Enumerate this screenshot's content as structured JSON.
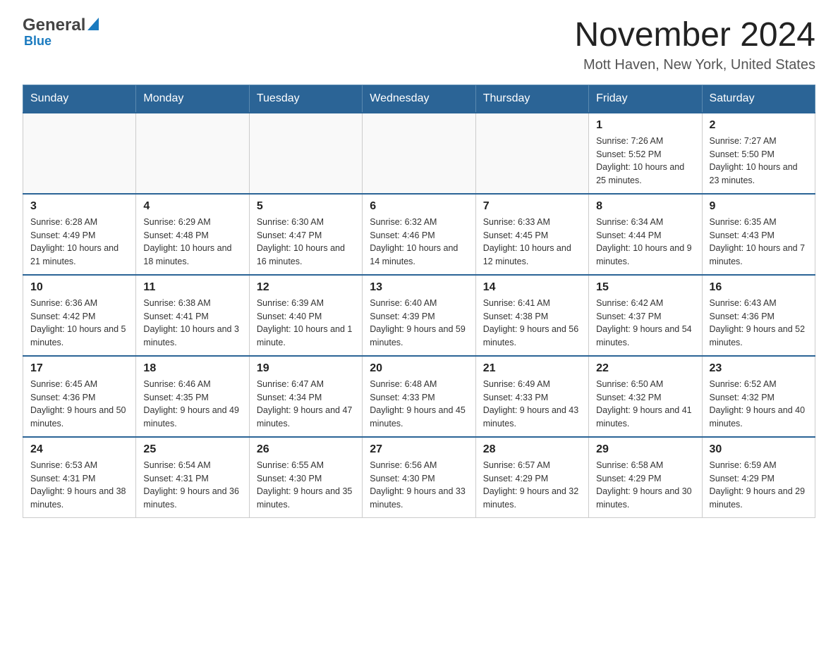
{
  "header": {
    "title": "November 2024",
    "subtitle": "Mott Haven, New York, United States",
    "logo_general": "General",
    "logo_blue": "Blue"
  },
  "days_of_week": [
    "Sunday",
    "Monday",
    "Tuesday",
    "Wednesday",
    "Thursday",
    "Friday",
    "Saturday"
  ],
  "weeks": [
    {
      "days": [
        {
          "num": "",
          "info": ""
        },
        {
          "num": "",
          "info": ""
        },
        {
          "num": "",
          "info": ""
        },
        {
          "num": "",
          "info": ""
        },
        {
          "num": "",
          "info": ""
        },
        {
          "num": "1",
          "info": "Sunrise: 7:26 AM\nSunset: 5:52 PM\nDaylight: 10 hours and 25 minutes."
        },
        {
          "num": "2",
          "info": "Sunrise: 7:27 AM\nSunset: 5:50 PM\nDaylight: 10 hours and 23 minutes."
        }
      ]
    },
    {
      "days": [
        {
          "num": "3",
          "info": "Sunrise: 6:28 AM\nSunset: 4:49 PM\nDaylight: 10 hours and 21 minutes."
        },
        {
          "num": "4",
          "info": "Sunrise: 6:29 AM\nSunset: 4:48 PM\nDaylight: 10 hours and 18 minutes."
        },
        {
          "num": "5",
          "info": "Sunrise: 6:30 AM\nSunset: 4:47 PM\nDaylight: 10 hours and 16 minutes."
        },
        {
          "num": "6",
          "info": "Sunrise: 6:32 AM\nSunset: 4:46 PM\nDaylight: 10 hours and 14 minutes."
        },
        {
          "num": "7",
          "info": "Sunrise: 6:33 AM\nSunset: 4:45 PM\nDaylight: 10 hours and 12 minutes."
        },
        {
          "num": "8",
          "info": "Sunrise: 6:34 AM\nSunset: 4:44 PM\nDaylight: 10 hours and 9 minutes."
        },
        {
          "num": "9",
          "info": "Sunrise: 6:35 AM\nSunset: 4:43 PM\nDaylight: 10 hours and 7 minutes."
        }
      ]
    },
    {
      "days": [
        {
          "num": "10",
          "info": "Sunrise: 6:36 AM\nSunset: 4:42 PM\nDaylight: 10 hours and 5 minutes."
        },
        {
          "num": "11",
          "info": "Sunrise: 6:38 AM\nSunset: 4:41 PM\nDaylight: 10 hours and 3 minutes."
        },
        {
          "num": "12",
          "info": "Sunrise: 6:39 AM\nSunset: 4:40 PM\nDaylight: 10 hours and 1 minute."
        },
        {
          "num": "13",
          "info": "Sunrise: 6:40 AM\nSunset: 4:39 PM\nDaylight: 9 hours and 59 minutes."
        },
        {
          "num": "14",
          "info": "Sunrise: 6:41 AM\nSunset: 4:38 PM\nDaylight: 9 hours and 56 minutes."
        },
        {
          "num": "15",
          "info": "Sunrise: 6:42 AM\nSunset: 4:37 PM\nDaylight: 9 hours and 54 minutes."
        },
        {
          "num": "16",
          "info": "Sunrise: 6:43 AM\nSunset: 4:36 PM\nDaylight: 9 hours and 52 minutes."
        }
      ]
    },
    {
      "days": [
        {
          "num": "17",
          "info": "Sunrise: 6:45 AM\nSunset: 4:36 PM\nDaylight: 9 hours and 50 minutes."
        },
        {
          "num": "18",
          "info": "Sunrise: 6:46 AM\nSunset: 4:35 PM\nDaylight: 9 hours and 49 minutes."
        },
        {
          "num": "19",
          "info": "Sunrise: 6:47 AM\nSunset: 4:34 PM\nDaylight: 9 hours and 47 minutes."
        },
        {
          "num": "20",
          "info": "Sunrise: 6:48 AM\nSunset: 4:33 PM\nDaylight: 9 hours and 45 minutes."
        },
        {
          "num": "21",
          "info": "Sunrise: 6:49 AM\nSunset: 4:33 PM\nDaylight: 9 hours and 43 minutes."
        },
        {
          "num": "22",
          "info": "Sunrise: 6:50 AM\nSunset: 4:32 PM\nDaylight: 9 hours and 41 minutes."
        },
        {
          "num": "23",
          "info": "Sunrise: 6:52 AM\nSunset: 4:32 PM\nDaylight: 9 hours and 40 minutes."
        }
      ]
    },
    {
      "days": [
        {
          "num": "24",
          "info": "Sunrise: 6:53 AM\nSunset: 4:31 PM\nDaylight: 9 hours and 38 minutes."
        },
        {
          "num": "25",
          "info": "Sunrise: 6:54 AM\nSunset: 4:31 PM\nDaylight: 9 hours and 36 minutes."
        },
        {
          "num": "26",
          "info": "Sunrise: 6:55 AM\nSunset: 4:30 PM\nDaylight: 9 hours and 35 minutes."
        },
        {
          "num": "27",
          "info": "Sunrise: 6:56 AM\nSunset: 4:30 PM\nDaylight: 9 hours and 33 minutes."
        },
        {
          "num": "28",
          "info": "Sunrise: 6:57 AM\nSunset: 4:29 PM\nDaylight: 9 hours and 32 minutes."
        },
        {
          "num": "29",
          "info": "Sunrise: 6:58 AM\nSunset: 4:29 PM\nDaylight: 9 hours and 30 minutes."
        },
        {
          "num": "30",
          "info": "Sunrise: 6:59 AM\nSunset: 4:29 PM\nDaylight: 9 hours and 29 minutes."
        }
      ]
    }
  ]
}
